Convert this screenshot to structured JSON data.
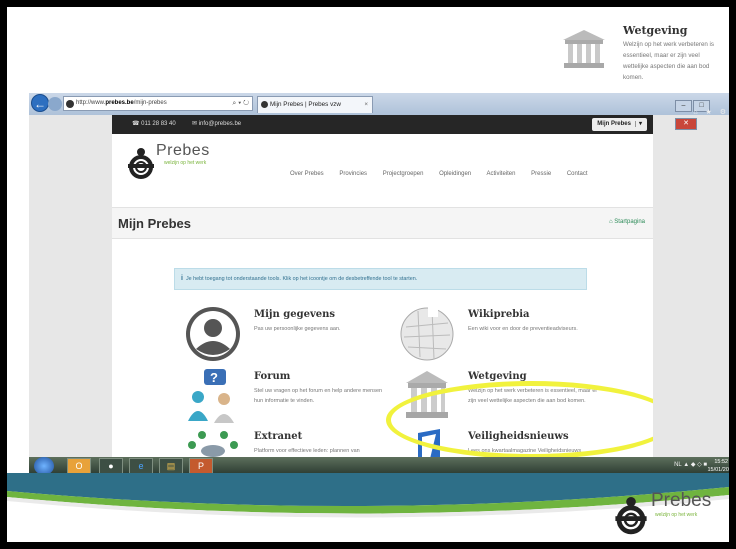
{
  "callout": {
    "title": "Wetgeving",
    "description": "Welzijn op het werk verbeteren is essentieel, maar er zijn veel wettelijke aspecten die aan bod komen."
  },
  "browser": {
    "url_prefix": "http://www.",
    "url_domain": "prebes.be",
    "url_path": "/mijn-prebes",
    "url_controls": "⌕ ▾ ↻",
    "tab_title": "Mijn Prebes | Prebes vzw",
    "tab_close": "×",
    "right_icons": "⌂ ★ ⚙"
  },
  "site": {
    "phone": "☎ 011 28 83 40",
    "email": "✉ info@prebes.be",
    "mijn_prebes_button": "Mijn Prebes",
    "mijn_prebes_caret": "▾",
    "logo_text": "Prebes",
    "logo_tagline": "welzijn op het werk",
    "nav": [
      "Over Prebes",
      "Provincies",
      "Projectgroepen",
      "Opleidingen",
      "Activiteiten",
      "Pressie",
      "Contact"
    ],
    "page_title": "Mijn Prebes",
    "home_link": "⌂ Startpagina",
    "info_icon": "i",
    "info_text": "Je hebt toegang tot onderstaande tools. Klik op het icoontje om de desbetreffende tool te starten.",
    "tiles": [
      {
        "name": "Mijn gegevens",
        "desc": "Pas uw persoonlijke gegevens aan."
      },
      {
        "name": "Wikiprebia",
        "desc": "Een wiki voor en door de preventieadviseurs."
      },
      {
        "name": "Forum",
        "desc": "Stel uw vragen op het forum en help andere mensen hun informatie te vinden."
      },
      {
        "name": "Wetgeving",
        "desc": "Welzijn op het werk verbeteren is essentieel, maar er zijn veel wettelijke aspecten die aan bod komen."
      },
      {
        "name": "Extranet",
        "desc": "Platform voor effectieve leden: plannen van vergaderingen uitwisselen van verslagen."
      },
      {
        "name": "Veiligheidsnieuws",
        "desc": "Lees ons kwartaalmagazine Veiligheidsnieuws online."
      }
    ]
  },
  "taskbar": {
    "tray": "NL ▲ ◆ ◇ ■",
    "time": "15:52",
    "date": "15/01/2016"
  },
  "bottom_logo": {
    "word": "Prebes",
    "tagline": "welzijn op het werk"
  }
}
